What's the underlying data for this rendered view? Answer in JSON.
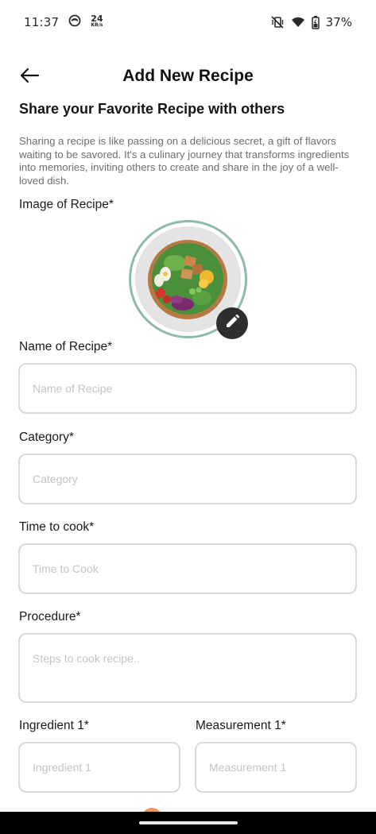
{
  "status_bar": {
    "time": "11:37",
    "speed_value": "24",
    "speed_unit": "KB/s",
    "battery_percent": "37%"
  },
  "header": {
    "title": "Add New Recipe"
  },
  "subtitle": "Share your Favorite Recipe with others",
  "intro": "Sharing a recipe is like passing on a delicious secret, a gift of flavors waiting to be savored. It's a culinary journey that transforms ingredients into memories, inviting others to create and share in the joy of a well-loved dish.",
  "image_section": {
    "label": "Image of Recipe*"
  },
  "fields": {
    "name": {
      "label": "Name of Recipe*",
      "placeholder": "Name of Recipe"
    },
    "category": {
      "label": "Category*",
      "placeholder": "Category"
    },
    "time": {
      "label": "Time to cook*",
      "placeholder": "Time to Cook"
    },
    "procedure": {
      "label": "Procedure*",
      "placeholder": "Steps to cook recipe.."
    },
    "ingredient": {
      "label": "Ingredient 1*",
      "placeholder": "Ingredient 1"
    },
    "measurement": {
      "label": "Measurement 1*",
      "placeholder": "Measurement 1"
    }
  },
  "colors": {
    "image_ring": "#8fb9ac",
    "edit_button": "#2e2e2e",
    "input_border": "#d9d9d9",
    "placeholder": "#c4c4c4"
  }
}
